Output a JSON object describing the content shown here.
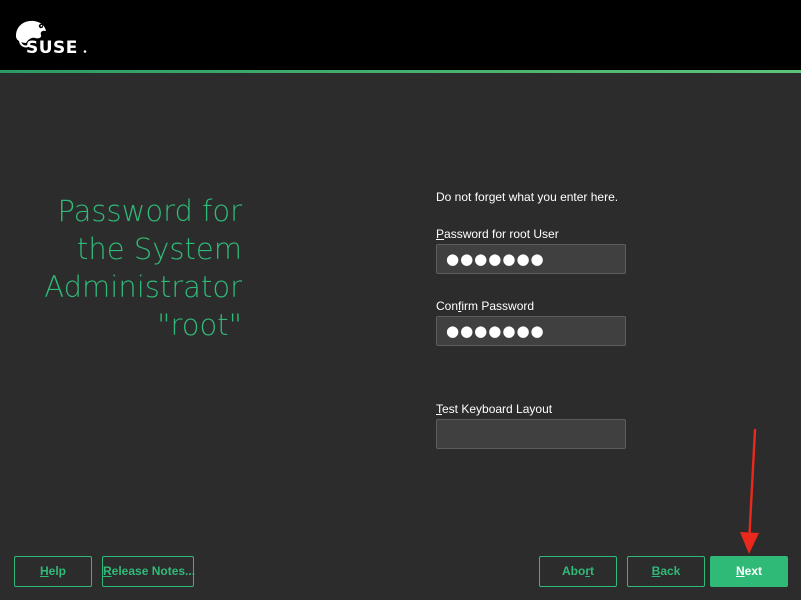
{
  "brand": {
    "name": "SUSE",
    "colors": {
      "accent": "#30ba78",
      "background": "#2c2c2c",
      "topbar": "#000000",
      "field": "#404040",
      "arrow": "#e8291c"
    }
  },
  "heading": {
    "lines": [
      "Password for",
      "the System",
      "Administrator",
      "\"root\""
    ]
  },
  "form": {
    "hint": "Do not forget what you enter here.",
    "password": {
      "label_mnemonic": "P",
      "label_rest": "assword for root User",
      "value": "●●●●●●●"
    },
    "confirm": {
      "label_before": "Con",
      "label_mnemonic": "f",
      "label_after": "irm Password",
      "value": "●●●●●●●"
    },
    "keyboard": {
      "label_mnemonic": "T",
      "label_rest": "est Keyboard Layout",
      "value": ""
    }
  },
  "buttons": {
    "help": {
      "mnemonic": "H",
      "rest": "elp"
    },
    "release_notes": {
      "mnemonic": "R",
      "rest": "elease Notes..."
    },
    "abort": {
      "before": "Abo",
      "mnemonic": "r",
      "after": "t"
    },
    "back": {
      "mnemonic": "B",
      "rest": "ack"
    },
    "next": {
      "mnemonic": "N",
      "rest": "ext"
    }
  }
}
